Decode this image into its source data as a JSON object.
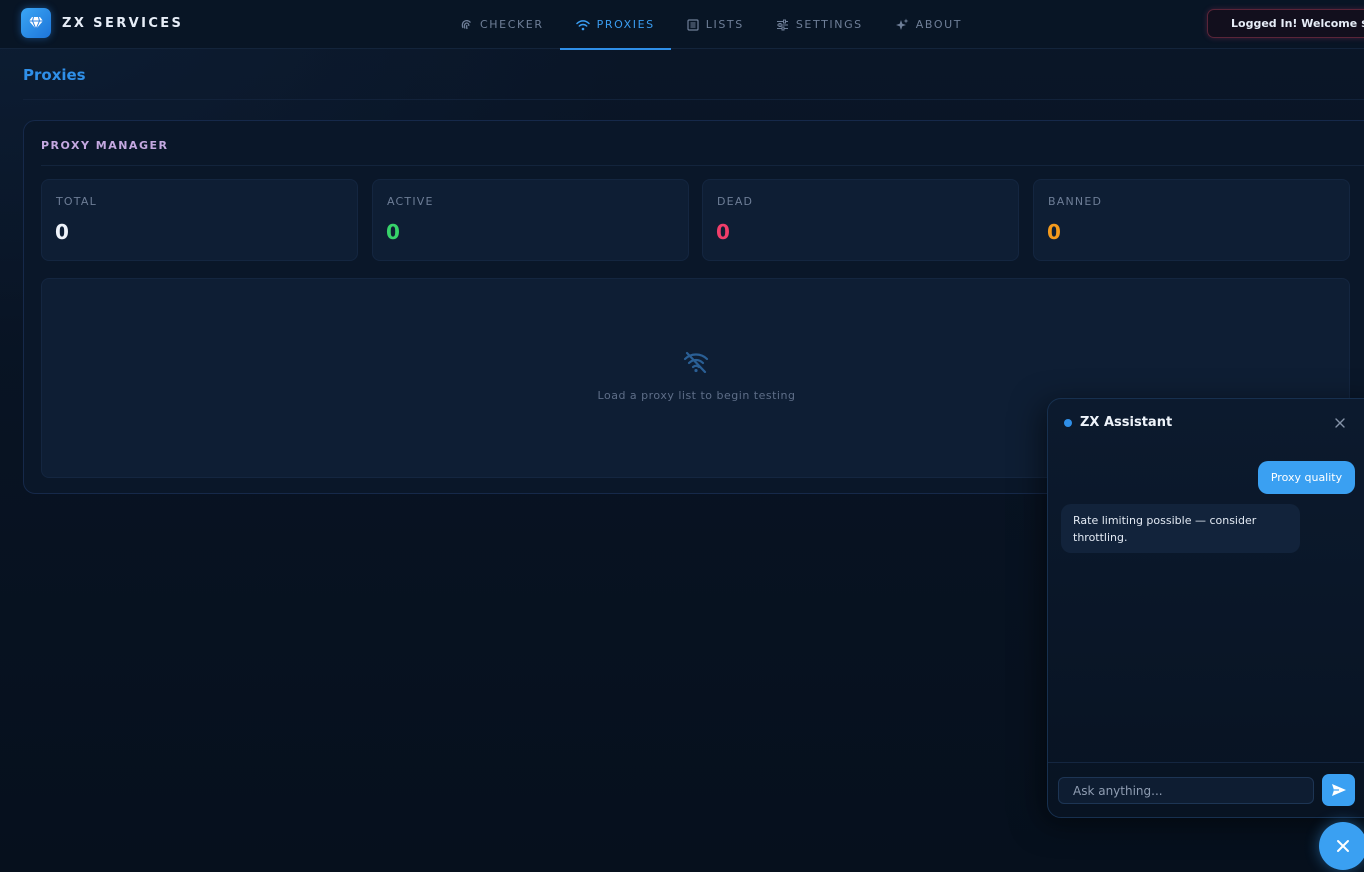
{
  "brand": {
    "name": "ZX SERVICES",
    "logo_icon": "gem-icon"
  },
  "nav": [
    {
      "label": "CHECKER",
      "icon": "fingerprint-icon",
      "active": false
    },
    {
      "label": "PROXIES",
      "icon": "wifi-icon",
      "active": true
    },
    {
      "label": "LISTS",
      "icon": "list-icon",
      "active": false
    },
    {
      "label": "SETTINGS",
      "icon": "sliders-icon",
      "active": false
    },
    {
      "label": "ABOUT",
      "icon": "sparkles-icon",
      "active": false
    }
  ],
  "login_status": {
    "text": "Logged In! Welcome ${s",
    "dot_color": "#ff4f8a"
  },
  "page": {
    "title": "Proxies"
  },
  "proxy_manager": {
    "title": "PROXY MANAGER",
    "stats": [
      {
        "label": "TOTAL",
        "value": "0",
        "color": "#eef3fa"
      },
      {
        "label": "ACTIVE",
        "value": "0",
        "color": "#37d36a"
      },
      {
        "label": "DEAD",
        "value": "0",
        "color": "#f03e6a"
      },
      {
        "label": "BANNED",
        "value": "0",
        "color": "#f39a1d"
      }
    ],
    "empty_state": {
      "icon": "wifi-off-icon",
      "text": "Load a proxy list to begin testing"
    }
  },
  "assistant": {
    "title": "ZX Assistant",
    "messages": [
      {
        "role": "user",
        "text": "Proxy quality"
      },
      {
        "role": "assistant",
        "text": "Rate limiting possible — consider throttling."
      }
    ],
    "input_placeholder": "Ask anything...",
    "input_value": ""
  },
  "colors": {
    "accent": "#3aa0f2",
    "active_nav": "#3a9cf0",
    "page_bg": "#07111f"
  }
}
